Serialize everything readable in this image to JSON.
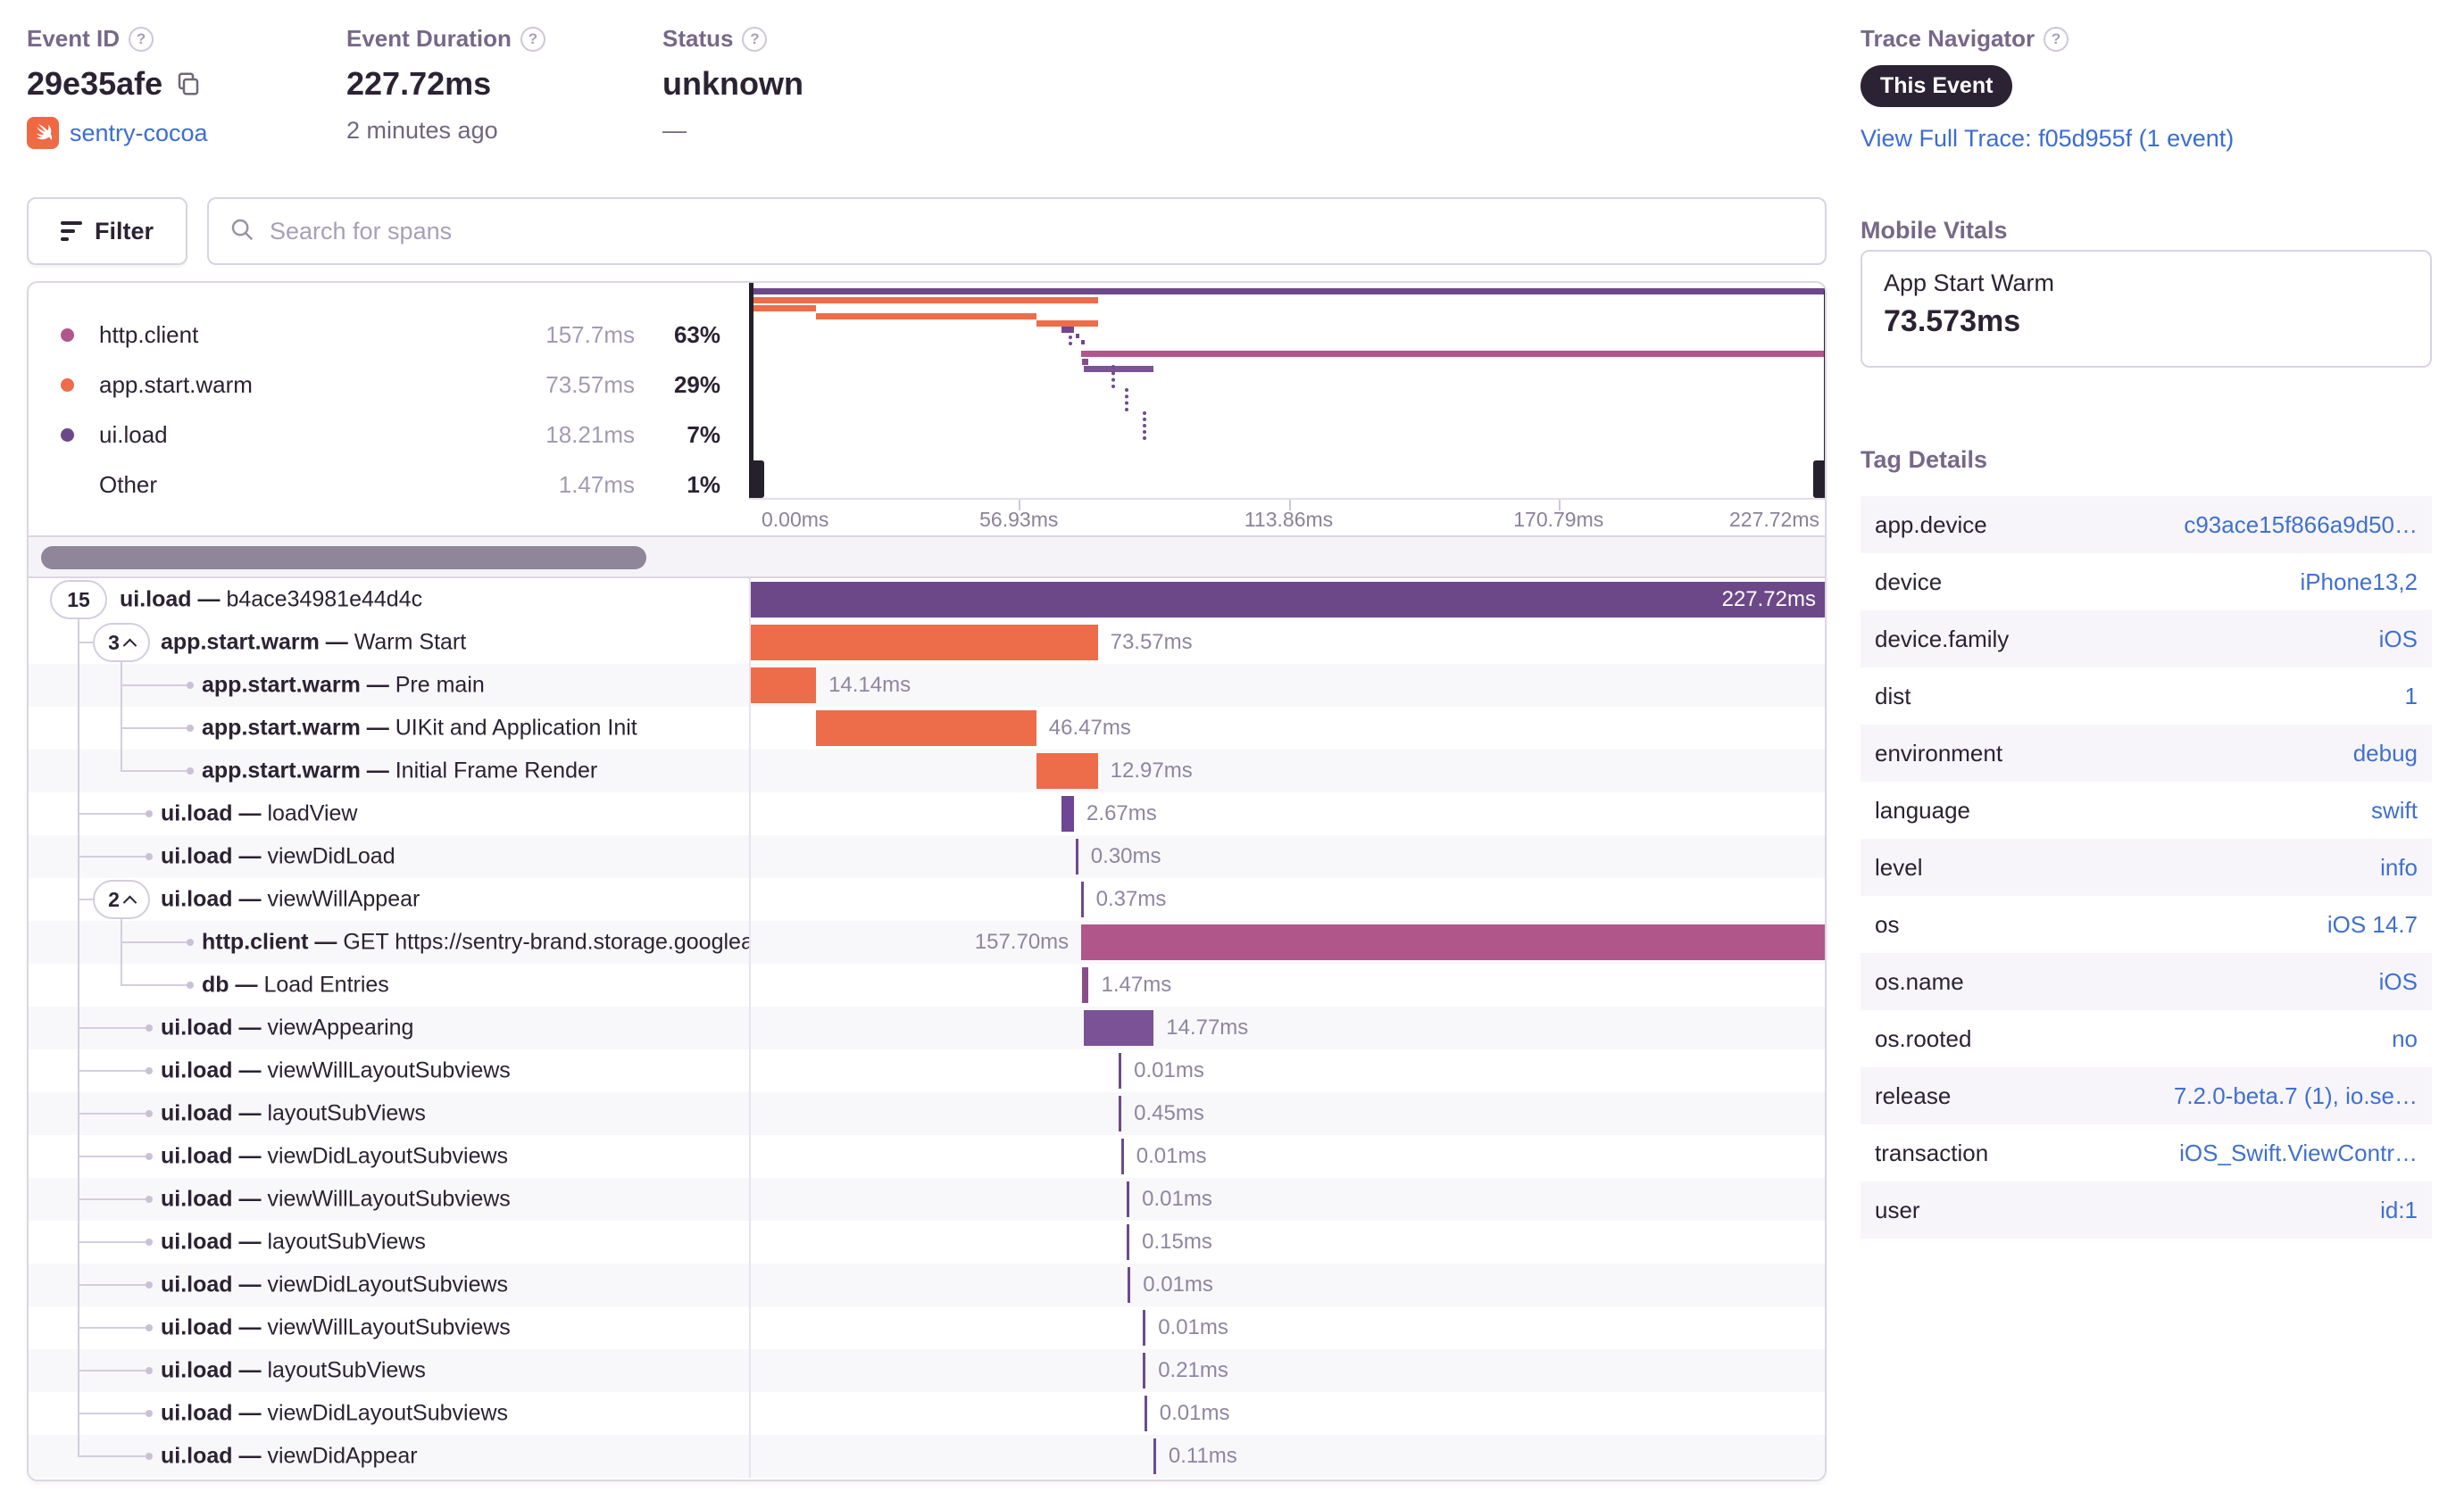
{
  "header": {
    "event_id": {
      "label": "Event ID",
      "value": "29e35afe",
      "project": "sentry-cocoa"
    },
    "event_duration": {
      "label": "Event Duration",
      "value": "227.72ms",
      "subtitle": "2 minutes ago"
    },
    "status": {
      "label": "Status",
      "value": "unknown",
      "subtitle": "—"
    }
  },
  "trace_navigator": {
    "label": "Trace Navigator",
    "badge": "This Event",
    "link": "View Full Trace: f05d955f (1 event)"
  },
  "toolbar": {
    "filter_label": "Filter",
    "search_placeholder": "Search for spans"
  },
  "legend": [
    {
      "name": "http.client",
      "duration": "157.7ms",
      "percent": "63%",
      "color": "#b0568a"
    },
    {
      "name": "app.start.warm",
      "duration": "73.57ms",
      "percent": "29%",
      "color": "#ed6c49"
    },
    {
      "name": "ui.load",
      "duration": "18.21ms",
      "percent": "7%",
      "color": "#6d4889"
    },
    {
      "name": "Other",
      "duration": "1.47ms",
      "percent": "1%",
      "color": ""
    }
  ],
  "timeline": {
    "total_ms": 227.72,
    "axis_ticks": [
      "0.00ms",
      "56.93ms",
      "113.86ms",
      "170.79ms",
      "227.72ms"
    ]
  },
  "spans": [
    {
      "op": "ui.load",
      "description": "b4ace34981e44d4c",
      "badge": "15",
      "expandable": false,
      "depth": 0,
      "start_ms": 0,
      "duration_ms": 227.72,
      "duration_label": "227.72ms",
      "color": "#6d4889",
      "label_pos": "inside"
    },
    {
      "op": "app.start.warm",
      "description": "Warm Start",
      "badge": "3",
      "expandable": true,
      "depth": 1,
      "start_ms": 0,
      "duration_ms": 73.57,
      "duration_label": "73.57ms",
      "color": "#ed6c49",
      "label_pos": "right"
    },
    {
      "op": "app.start.warm",
      "description": "Pre main",
      "depth": 2,
      "start_ms": 0,
      "duration_ms": 14.14,
      "duration_label": "14.14ms",
      "color": "#ed6c49",
      "label_pos": "right"
    },
    {
      "op": "app.start.warm",
      "description": "UIKit and Application Init",
      "depth": 2,
      "start_ms": 14.14,
      "duration_ms": 46.47,
      "duration_label": "46.47ms",
      "color": "#ed6c49",
      "label_pos": "right"
    },
    {
      "op": "app.start.warm",
      "description": "Initial Frame Render",
      "depth": 2,
      "start_ms": 60.61,
      "duration_ms": 12.97,
      "duration_label": "12.97ms",
      "color": "#ed6c49",
      "label_pos": "right"
    },
    {
      "op": "ui.load",
      "description": "loadView",
      "depth": 1,
      "start_ms": 65.9,
      "duration_ms": 2.67,
      "duration_label": "2.67ms",
      "color": "#6f4596",
      "label_pos": "right"
    },
    {
      "op": "ui.load",
      "description": "viewDidLoad",
      "depth": 1,
      "start_ms": 68.9,
      "duration_ms": 0.3,
      "duration_label": "0.30ms",
      "color": "#6e4a8d",
      "label_pos": "right"
    },
    {
      "op": "ui.load",
      "description": "viewWillAppear",
      "badge": "2",
      "expandable": true,
      "depth": 1,
      "start_ms": 70.0,
      "duration_ms": 0.37,
      "duration_label": "0.37ms",
      "color": "#6e4a8d",
      "label_pos": "right"
    },
    {
      "op": "http.client",
      "description": "GET https://sentry-brand.storage.googlea",
      "depth": 2,
      "start_ms": 70.1,
      "duration_ms": 157.7,
      "duration_label": "157.70ms",
      "color": "#b0568a",
      "label_pos": "left"
    },
    {
      "op": "db",
      "description": "Load Entries",
      "depth": 2,
      "start_ms": 70.2,
      "duration_ms": 1.47,
      "duration_label": "1.47ms",
      "color": "#8a4d8c",
      "label_pos": "right"
    },
    {
      "op": "ui.load",
      "description": "viewAppearing",
      "depth": 1,
      "start_ms": 70.6,
      "duration_ms": 14.77,
      "duration_label": "14.77ms",
      "color": "#7a5295",
      "label_pos": "right"
    },
    {
      "op": "ui.load",
      "description": "viewWillLayoutSubviews",
      "depth": 1,
      "start_ms": 78.0,
      "duration_ms": 0.01,
      "duration_label": "0.01ms",
      "color": "#6e4a8d",
      "label_pos": "right"
    },
    {
      "op": "ui.load",
      "description": "layoutSubViews",
      "depth": 1,
      "start_ms": 78.0,
      "duration_ms": 0.45,
      "duration_label": "0.45ms",
      "color": "#6e4a8d",
      "label_pos": "right"
    },
    {
      "op": "ui.load",
      "description": "viewDidLayoutSubviews",
      "depth": 1,
      "start_ms": 78.5,
      "duration_ms": 0.01,
      "duration_label": "0.01ms",
      "color": "#6e4a8d",
      "label_pos": "right"
    },
    {
      "op": "ui.load",
      "description": "viewWillLayoutSubviews",
      "depth": 1,
      "start_ms": 79.7,
      "duration_ms": 0.01,
      "duration_label": "0.01ms",
      "color": "#6e4a8d",
      "label_pos": "right"
    },
    {
      "op": "ui.load",
      "description": "layoutSubViews",
      "depth": 1,
      "start_ms": 79.7,
      "duration_ms": 0.15,
      "duration_label": "0.15ms",
      "color": "#6e4a8d",
      "label_pos": "right"
    },
    {
      "op": "ui.load",
      "description": "viewDidLayoutSubviews",
      "depth": 1,
      "start_ms": 79.9,
      "duration_ms": 0.01,
      "duration_label": "0.01ms",
      "color": "#6e4a8d",
      "label_pos": "right"
    },
    {
      "op": "ui.load",
      "description": "viewWillLayoutSubviews",
      "depth": 1,
      "start_ms": 83.1,
      "duration_ms": 0.01,
      "duration_label": "0.01ms",
      "color": "#6e4a8d",
      "label_pos": "right"
    },
    {
      "op": "ui.load",
      "description": "layoutSubViews",
      "depth": 1,
      "start_ms": 83.1,
      "duration_ms": 0.21,
      "duration_label": "0.21ms",
      "color": "#6e4a8d",
      "label_pos": "right"
    },
    {
      "op": "ui.load",
      "description": "viewDidLayoutSubviews",
      "depth": 1,
      "start_ms": 83.4,
      "duration_ms": 0.01,
      "duration_label": "0.01ms",
      "color": "#6e4a8d",
      "label_pos": "right"
    },
    {
      "op": "ui.load",
      "description": "viewDidAppear",
      "depth": 1,
      "start_ms": 85.3,
      "duration_ms": 0.11,
      "duration_label": "0.11ms",
      "color": "#6e4a8d",
      "label_pos": "right"
    }
  ],
  "mobile_vitals": {
    "title": "Mobile Vitals",
    "metric": "App Start Warm",
    "value": "73.573ms"
  },
  "tag_details": {
    "title": "Tag Details",
    "rows": [
      {
        "key": "app.device",
        "value": "c93ace15f866a9d50…"
      },
      {
        "key": "device",
        "value": "iPhone13,2"
      },
      {
        "key": "device.family",
        "value": "iOS"
      },
      {
        "key": "dist",
        "value": "1"
      },
      {
        "key": "environment",
        "value": "debug"
      },
      {
        "key": "language",
        "value": "swift"
      },
      {
        "key": "level",
        "value": "info"
      },
      {
        "key": "os",
        "value": "iOS 14.7"
      },
      {
        "key": "os.name",
        "value": "iOS"
      },
      {
        "key": "os.rooted",
        "value": "no"
      },
      {
        "key": "release",
        "value": "7.2.0-beta.7 (1), io.se…"
      },
      {
        "key": "transaction",
        "value": "iOS_Swift.ViewContr…"
      },
      {
        "key": "user",
        "value": "id:1"
      }
    ]
  },
  "colors": {
    "orange": "#ed6c49",
    "magenta": "#b0568a",
    "purple": "#6d4889",
    "link": "#3b6dd3"
  }
}
